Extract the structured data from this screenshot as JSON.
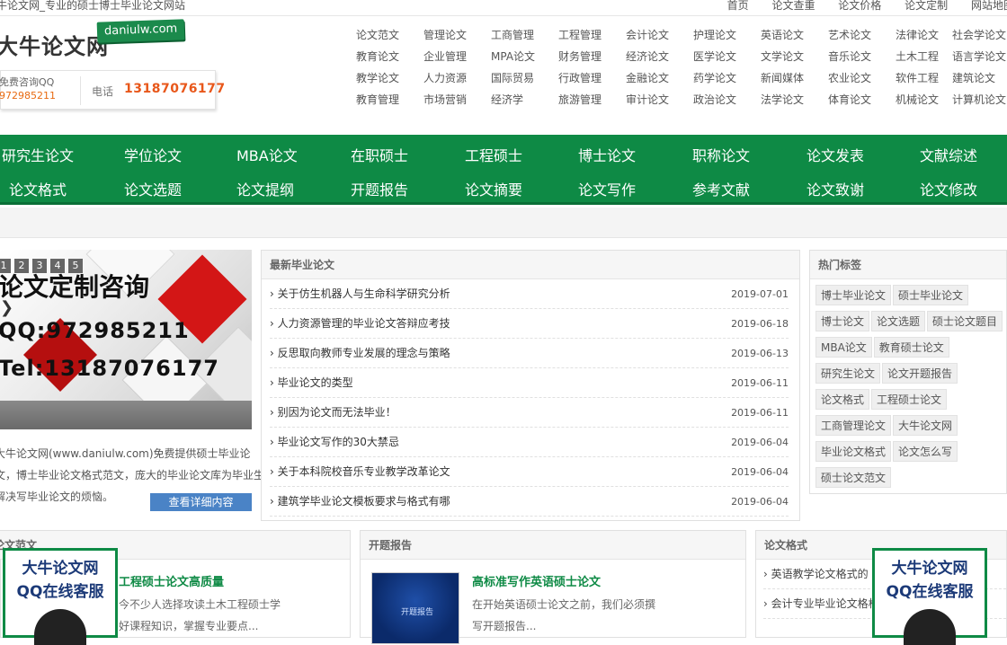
{
  "topbar": {
    "slogan": "牛论文网_专业的硕士博士毕业论文网站",
    "links": [
      "首页",
      "论文查重",
      "论文价格",
      "论文定制",
      "网站地图"
    ]
  },
  "header": {
    "logo": "大牛论文网",
    "logo_tag": "daniulw.com",
    "qq_label": "免费咨询QQ",
    "qq_number": "972985211",
    "tel_label": "电话",
    "tel": "13187076177",
    "categories": [
      [
        "论文范文",
        "管理论文",
        "工商管理",
        "工程管理",
        "会计论文",
        "护理论文",
        "英语论文",
        "艺术论文",
        "法律论文",
        "社会学论文"
      ],
      [
        "教育论文",
        "企业管理",
        "MPA论文",
        "财务管理",
        "经济论文",
        "医学论文",
        "文学论文",
        "音乐论文",
        "土木工程",
        "语言学论文"
      ],
      [
        "教学论文",
        "人力资源",
        "国际贸易",
        "行政管理",
        "金融论文",
        "药学论文",
        "新闻媒体",
        "农业论文",
        "软件工程",
        "建筑论文"
      ],
      [
        "教育管理",
        "市场营销",
        "经济学",
        "旅游管理",
        "审计论文",
        "政治论文",
        "法学论文",
        "体育论文",
        "机械论文",
        "计算机论文"
      ]
    ]
  },
  "nav": {
    "row1": [
      "研究生论文",
      "学位论文",
      "MBA论文",
      "在职硕士",
      "工程硕士",
      "博士论文",
      "职称论文",
      "论文发表",
      "文献综述"
    ],
    "row2": [
      "论文格式",
      "论文选题",
      "论文提纲",
      "开题报告",
      "论文摘要",
      "论文写作",
      "参考文献",
      "论文致谢",
      "论文修改"
    ]
  },
  "banner": {
    "pager": [
      "1",
      "2",
      "3",
      "4",
      "5"
    ],
    "title": "论文定制咨询",
    "qq": "QQ:972985211",
    "tel": "Tel:13187076177"
  },
  "intro": {
    "lines": [
      "大牛论文网(www.daniulw.com)免费提供硕士毕业论",
      "文，博士毕业论文格式范文，庞大的毕业论文库为毕业生",
      "解决写毕业论文的烦恼。"
    ],
    "more": "查看详细内容"
  },
  "latest": {
    "title": "最新毕业论文",
    "items": [
      {
        "title": "关于仿生机器人与生命科学研究分析",
        "date": "2019-07-01"
      },
      {
        "title": "人力资源管理的毕业论文答辩应考技",
        "date": "2019-06-18"
      },
      {
        "title": "反思取向教师专业发展的理念与策略",
        "date": "2019-06-13"
      },
      {
        "title": "毕业论文的类型",
        "date": "2019-06-11"
      },
      {
        "title": "别因为论文而无法毕业！",
        "date": "2019-06-11"
      },
      {
        "title": "毕业论文写作的30大禁忌",
        "date": "2019-06-04"
      },
      {
        "title": "关于本科院校音乐专业教学改革论文",
        "date": "2019-06-04"
      },
      {
        "title": "建筑学毕业论文模板要求与格式有哪",
        "date": "2019-06-04"
      }
    ]
  },
  "tags": {
    "title": "热门标签",
    "items": [
      "博士毕业论文",
      "硕士毕业论文",
      "博士论文",
      "论文选题",
      "硕士论文题目",
      "MBA论文",
      "教育硕士论文",
      "研究生论文",
      "论文开题报告",
      "论文格式",
      "工程硕士论文",
      "工商管理论文",
      "大牛论文网",
      "毕业论文格式",
      "论文怎么写",
      "硕士论文范文"
    ]
  },
  "bottom": {
    "p1": {
      "title": "论文范文",
      "headline": "工程硕士论文高质量",
      "lines": [
        "今不少人选择攻读土木工程硕士学",
        "好课程知识，掌握专业要点..."
      ]
    },
    "p2": {
      "title": "开题报告",
      "thumb": "开题报告",
      "headline": "高标准写作英语硕士论文",
      "lines": [
        "在开始英语硕士论文之前，我们必须撰",
        "写开题报告..."
      ]
    },
    "p3": {
      "title": "论文格式",
      "items": [
        "英语教学论文格式的",
        "会计专业毕业论文格格"
      ]
    }
  },
  "float_qq": {
    "line1": "大牛论文网",
    "line2": "QQ在线客服"
  }
}
